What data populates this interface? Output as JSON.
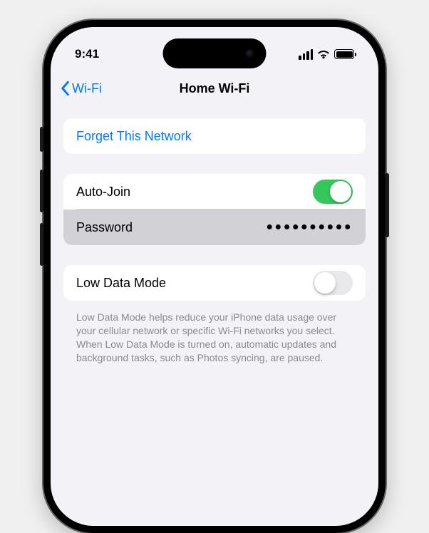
{
  "status": {
    "time": "9:41"
  },
  "nav": {
    "back_label": "Wi-Fi",
    "title": "Home Wi-Fi"
  },
  "sections": {
    "forget": {
      "label": "Forget This Network"
    },
    "auto_join": {
      "label": "Auto-Join",
      "on": true
    },
    "password": {
      "label": "Password",
      "masked_value": "●●●●●●●●●●"
    },
    "low_data": {
      "label": "Low Data Mode",
      "on": false,
      "footer": "Low Data Mode helps reduce your iPhone data usage over your cellular network or specific Wi-Fi networks you select. When Low Data Mode is turned on, automatic updates and background tasks, such as Photos syncing, are paused."
    }
  }
}
